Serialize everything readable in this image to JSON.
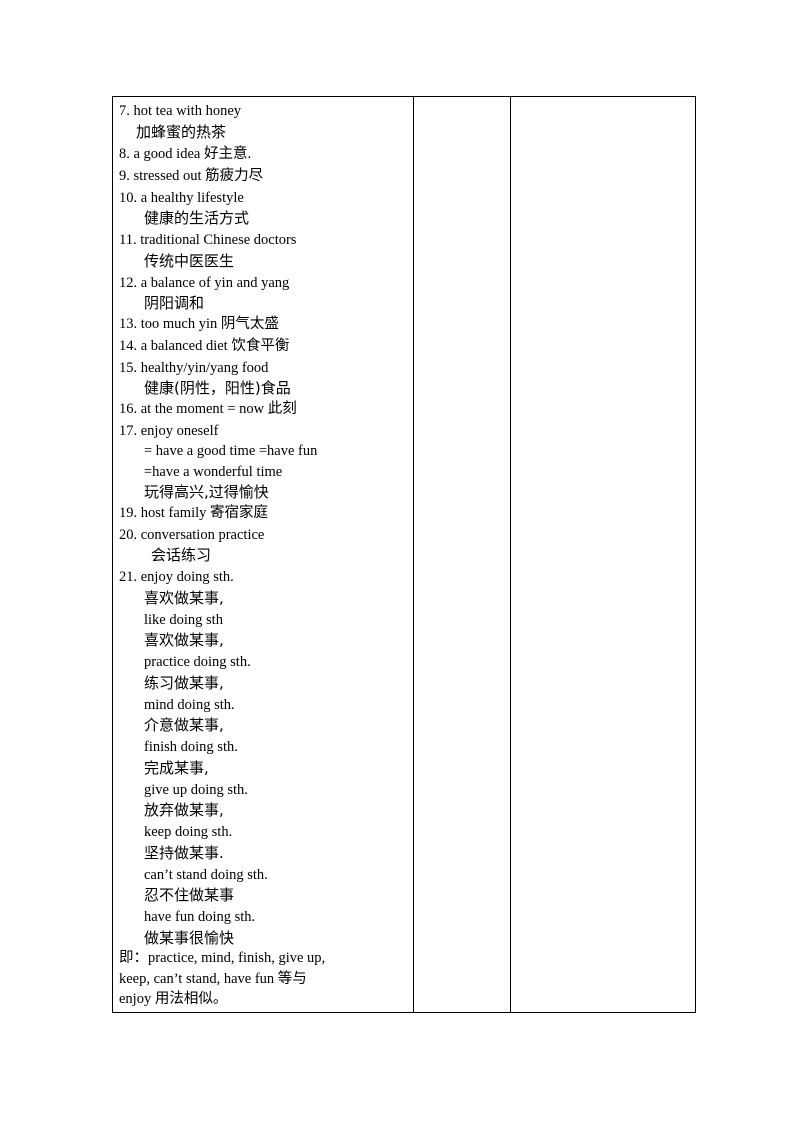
{
  "table": {
    "column1": {
      "entries": [
        {
          "en": "7. hot tea with honey",
          "zh": "加蜂蜜的热茶"
        },
        {
          "line": "8. a good idea  好主意."
        },
        {
          "line": "9. stressed out  筋疲力尽"
        },
        {
          "en": "10. a healthy lifestyle",
          "zh": "健康的生活方式"
        },
        {
          "en": "11. traditional Chinese doctors",
          "zh": "传统中医医生"
        },
        {
          "en": "12. a balance of yin and yang",
          "zh": "阴阳调和"
        },
        {
          "line": "13. too much yin  阴气太盛"
        },
        {
          "line": "14. a balanced diet 饮食平衡"
        },
        {
          "en": "15. healthy/yin/yang food",
          "zh": "健康(阴性，阳性)食品"
        },
        {
          "line": "16. at the moment = now  此刻"
        },
        {
          "en": "17. enjoy oneself",
          "syn1": "= have a good time =have fun",
          "syn2": "=have a wonderful time",
          "zh": "玩得高兴,过得愉快"
        },
        {
          "line": "19. host family  寄宿家庭"
        },
        {
          "en": "20. conversation practice",
          "zh": "会话练习"
        },
        {
          "en": "21. enjoy doing sth.",
          "zh": "喜欢做某事,"
        },
        {
          "en": "like doing sth",
          "zh": "喜欢做某事,"
        },
        {
          "en": "practice doing sth.",
          "zh": "练习做某事,"
        },
        {
          "en": "mind doing sth.",
          "zh": "介意做某事,"
        },
        {
          "en": "finish doing sth.",
          "zh": "完成某事,"
        },
        {
          "en": "give up doing sth.",
          "zh": "放弃做某事,"
        },
        {
          "en": "keep doing sth.",
          "zh": "坚持做某事."
        },
        {
          "en": "can’t stand doing sth.",
          "zh": "忍不住做某事"
        },
        {
          "en": "have fun doing sth.",
          "zh": "做某事很愉快"
        }
      ],
      "summary": [
        "即：practice, mind, finish, give up,",
        "keep, can’t stand, have fun 等与",
        "enjoy 用法相似。"
      ]
    },
    "column2": "",
    "column3": ""
  }
}
